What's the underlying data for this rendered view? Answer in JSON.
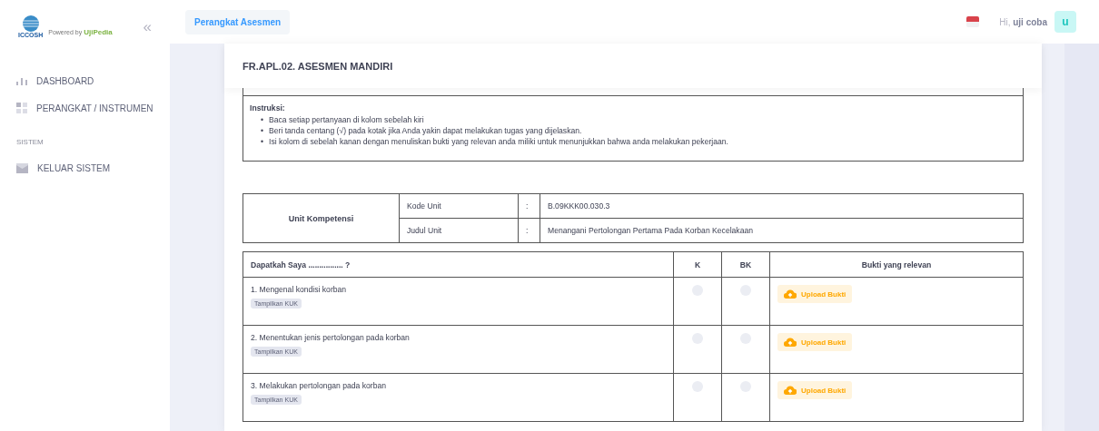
{
  "sidebar": {
    "logo": {
      "name": "ICCOSH",
      "powered_by": "Powered by",
      "brand": "UjiPedia"
    },
    "collapse_icon": "«",
    "items": [
      {
        "label": "DASHBOARD",
        "kind": "link"
      },
      {
        "label": "PERANGKAT / INSTRUMEN",
        "kind": "link"
      },
      {
        "label": "SISTEM",
        "kind": "section"
      },
      {
        "label": "KELUAR SISTEM",
        "kind": "link"
      }
    ]
  },
  "header": {
    "tab": "Perangkat Asesmen",
    "greeting": "Hi,",
    "user": "uji coba",
    "avatar": "u"
  },
  "card": {
    "title": "FR.APL.02. ASESMEN MANDIRI",
    "instructions": {
      "heading": "Instruksi:",
      "marker": "•",
      "items": [
        "Baca setiap pertanyaan di kolom sebelah kiri",
        "Beri tanda centang (√) pada kotak jika Anda yakin dapat melakukan tugas yang dijelaskan.",
        "Isi kolom di sebelah kanan dengan menuliskan bukti yang relevan anda miliki untuk menunjukkan bahwa anda melakukan pekerjaan."
      ]
    },
    "unit": {
      "heading": "Unit Kompetensi",
      "rows": [
        {
          "label": "Kode Unit",
          "sep": ":",
          "value": "B.09KKK00.030.3"
        },
        {
          "label": "Judul Unit",
          "sep": ":",
          "value": "Menangani Pertolongan Pertama Pada Korban Kecelakaan"
        }
      ]
    },
    "table": {
      "columns": [
        "Dapatkah Saya ................ ?",
        "K",
        "BK",
        "Bukti yang relevan"
      ],
      "rows": [
        {
          "question": "1. Mengenal kondisi korban",
          "kuk": "Tampilkan KUK",
          "k_selected": false,
          "bk_selected": false,
          "upload": "Upload Bukti"
        },
        {
          "question": "2. Menentukan jenis pertolongan pada korban",
          "kuk": "Tampilkan KUK",
          "k_selected": false,
          "bk_selected": false,
          "upload": "Upload Bukti"
        },
        {
          "question": "3. Melakukan pertolongan pada korban",
          "kuk": "Tampilkan KUK",
          "k_selected": false,
          "bk_selected": false,
          "upload": "Upload Bukti"
        }
      ]
    }
  }
}
